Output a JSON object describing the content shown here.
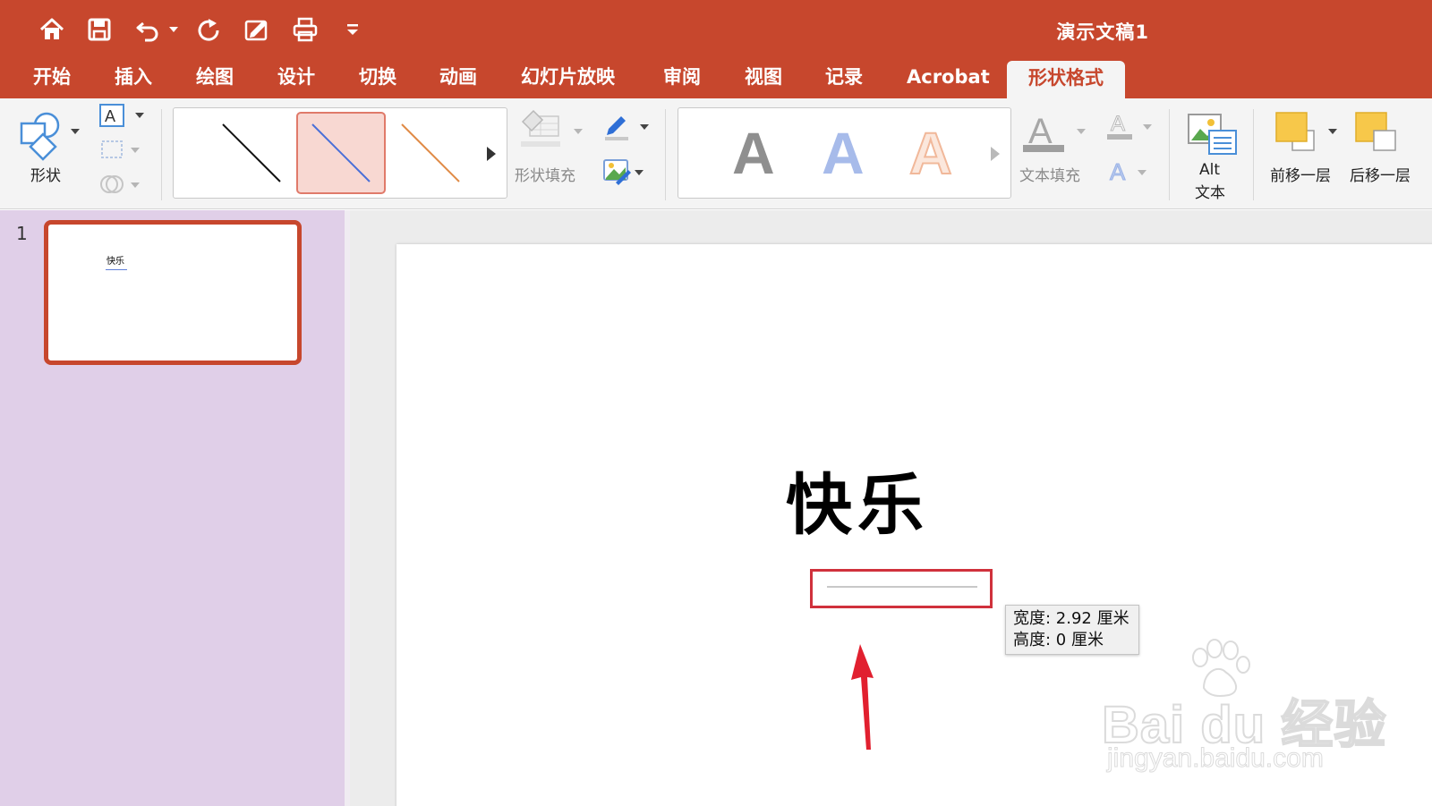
{
  "app": {
    "document_title": "演示文稿1"
  },
  "quick_access": {
    "icons": [
      "home-icon",
      "save-icon",
      "undo-icon",
      "redo-icon",
      "edit-doc-icon",
      "print-icon",
      "customize-icon"
    ]
  },
  "tabs": [
    {
      "label": "开始"
    },
    {
      "label": "插入"
    },
    {
      "label": "绘图"
    },
    {
      "label": "设计"
    },
    {
      "label": "切换"
    },
    {
      "label": "动画"
    },
    {
      "label": "幻灯片放映"
    },
    {
      "label": "审阅"
    },
    {
      "label": "视图"
    },
    {
      "label": "记录"
    },
    {
      "label": "Acrobat"
    },
    {
      "label": "形状格式",
      "active": true
    }
  ],
  "ribbon": {
    "shape_label": "形状",
    "shape_fill_label": "形状填充",
    "text_fill_label": "文本填充",
    "alt_text_label_1": "Alt",
    "alt_text_label_2": "文本",
    "bring_forward_label": "前移一层",
    "send_backward_label": "后移一层",
    "line_styles": [
      {
        "color": "#111111",
        "selected": false
      },
      {
        "color": "#4a6fd8",
        "selected": true
      },
      {
        "color": "#e08a45",
        "selected": false
      }
    ],
    "wordart_styles": [
      {
        "letter": "A",
        "color": "#8f8f8f"
      },
      {
        "letter": "A",
        "color": "#a7bbea"
      },
      {
        "letter": "A",
        "color": "#f7d8c6"
      }
    ]
  },
  "thumbnails": {
    "slide_number": "1",
    "text": "快乐"
  },
  "slide": {
    "title": "快乐"
  },
  "tooltip": {
    "width_text": "宽度: 2.92 厘米",
    "height_text": "高度: 0 厘米"
  },
  "watermark": {
    "logo_text": "Bai du 经验",
    "url": "jingyan.baidu.com"
  },
  "colors": {
    "accent": "#c7472d",
    "thumbnail_pane": "#e0cfe8",
    "highlight_box": "#d0313c"
  }
}
